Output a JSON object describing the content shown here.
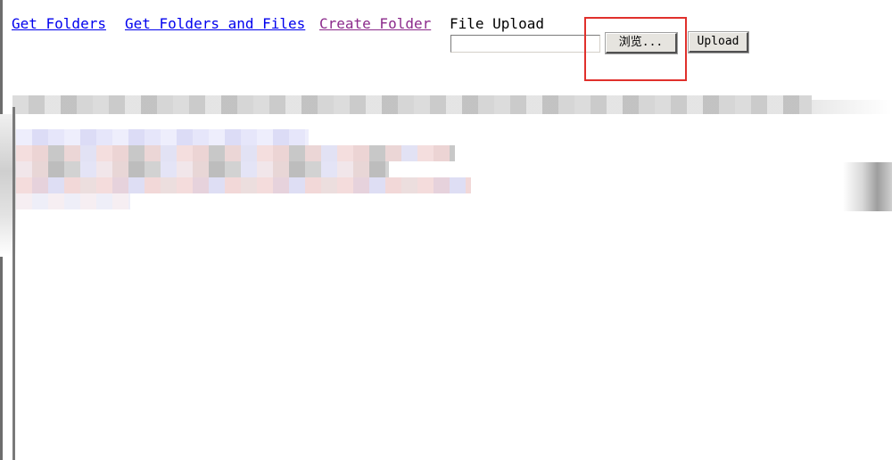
{
  "nav": {
    "links": [
      {
        "label": "Get Folders"
      },
      {
        "label": "Get Folders and Files"
      },
      {
        "label": "Create Folder"
      }
    ]
  },
  "upload": {
    "label": "File Upload",
    "file_value": "",
    "browse_label": "浏览...",
    "upload_label": "Upload"
  },
  "colors": {
    "link": "#0000ee",
    "visited_link": "#8b2a8b",
    "highlight": "#e0302c"
  }
}
